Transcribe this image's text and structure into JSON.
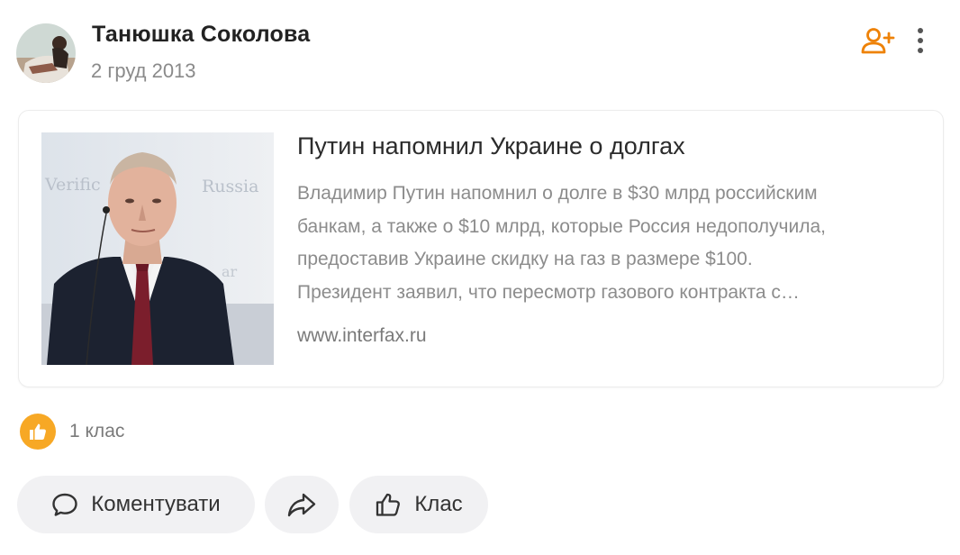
{
  "author": {
    "name": "Танюшка Соколова",
    "date": "2 груд 2013",
    "avatar_icon": "user-avatar"
  },
  "header_actions": {
    "add_friend_icon": "add-friend-icon",
    "more_icon": "more-vertical-icon"
  },
  "link_card": {
    "image_icon": "article-photo",
    "title": "Путин напомнил Украине о долгах",
    "description_lines": [
      "Владимир Путин напомнил о долге в $30 млрд российским",
      "банкам, а также о $10 млрд, которые Россия недополучила,",
      "предоставив Украине скидку на газ в размере $100.",
      "Президент заявил, что пересмотр газового контракта с…"
    ],
    "domain": "www.interfax.ru"
  },
  "likes": {
    "count_text": "1 клас",
    "badge_color": "#f7a825"
  },
  "actions": {
    "comment_label": "Коментувати",
    "share_icon": "share-icon",
    "like_label": "Клас"
  },
  "colors": {
    "accent": "#ee8208",
    "button_bg": "#f1f1f3"
  }
}
